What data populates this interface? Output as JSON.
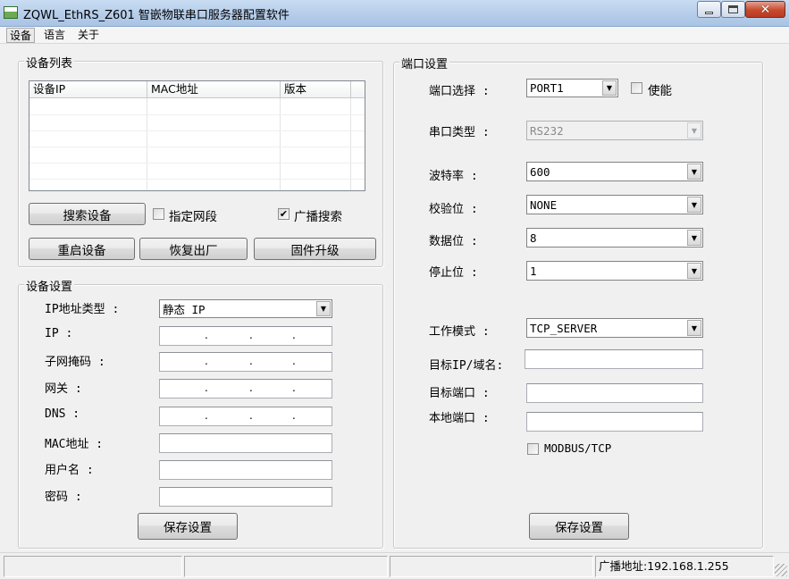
{
  "window": {
    "title": "ZQWL_EthRS_Z601  智嵌物联串口服务器配置软件"
  },
  "menu": [
    "设备",
    "语言",
    "关于"
  ],
  "device_list": {
    "group_title": "设备列表",
    "columns": [
      "设备IP",
      "MAC地址",
      "版本"
    ],
    "search_button": "搜索设备",
    "specify_segment_label": "指定网段",
    "specify_segment_checked": false,
    "broadcast_search_label": "广播搜索",
    "broadcast_search_checked": true,
    "restart_button": "重启设备",
    "factory_reset_button": "恢复出厂",
    "firmware_upgrade_button": "固件升级"
  },
  "device_settings": {
    "group_title": "设备设置",
    "ip_type_label": "IP地址类型  :",
    "ip_type_value": "静态 IP",
    "ip_label": "IP        :",
    "subnet_label": "子网掩码  :",
    "gateway_label": "网关     :",
    "dns_label": "DNS       :",
    "mac_label": "MAC地址   :",
    "username_label": "用户名    :",
    "password_label": "密码     :",
    "save_button": "保存设置"
  },
  "port_settings": {
    "group_title": "端口设置",
    "port_select_label": "端口选择  :",
    "port_value": "PORT1",
    "enable_label": "使能",
    "enable_checked": false,
    "serial_type_label": "串口类型  :",
    "serial_type_value": "RS232",
    "baud_label": "波特率    :",
    "baud_value": "600",
    "parity_label": "校验位    :",
    "parity_value": "NONE",
    "databits_label": "数据位    :",
    "databits_value": "8",
    "stopbits_label": "停止位    :",
    "stopbits_value": "1",
    "work_mode_label": "工作模式  :",
    "work_mode_value": "TCP_SERVER",
    "target_ip_label": "目标IP/域名:",
    "target_port_label": "目标端口  :",
    "local_port_label": "本地端口  :",
    "modbus_label": "MODBUS/TCP",
    "modbus_checked": false,
    "save_button": "保存设置"
  },
  "status_bar": {
    "broadcast_address": "广播地址:192.168.1.255"
  },
  "symbols": {
    "dropdown_arrow": "▼",
    "checked_mark": "✔",
    "close_x": "✕"
  }
}
